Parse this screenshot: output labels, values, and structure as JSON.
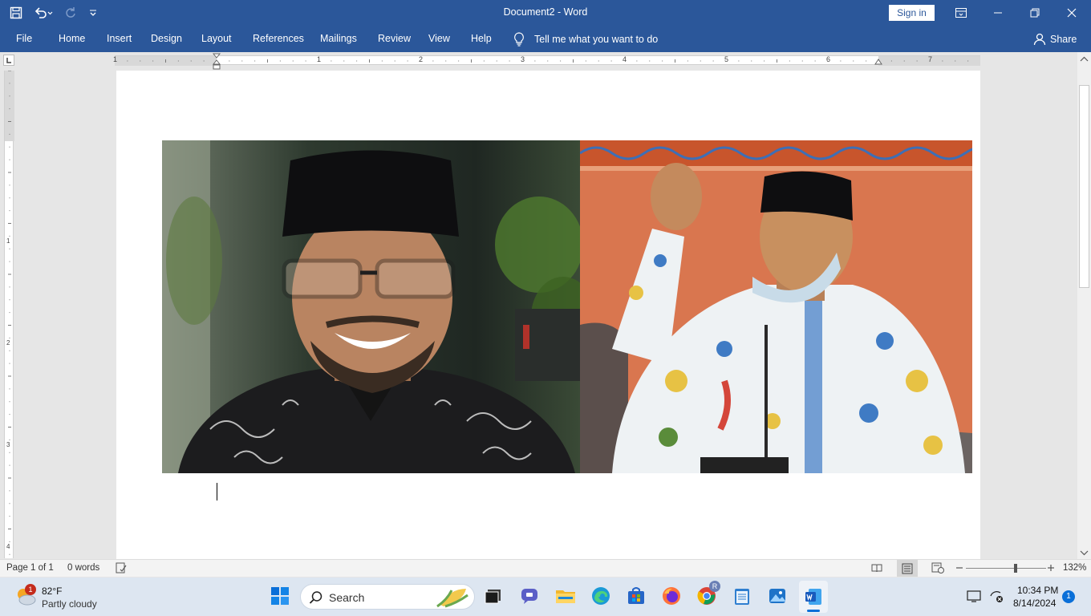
{
  "window": {
    "title": "Document2  -  Word",
    "sign_in": "Sign in"
  },
  "ribbon": {
    "tabs": [
      "File",
      "Home",
      "Insert",
      "Design",
      "Layout",
      "References",
      "Mailings",
      "Review",
      "View",
      "Help"
    ],
    "tell_me": "Tell me what you want to do",
    "share": "Share"
  },
  "ruler": {
    "h_numbers": [
      "1",
      "1",
      "2",
      "3",
      "4",
      "5",
      "6",
      "7"
    ],
    "v_numbers": [
      "1",
      "2",
      "3",
      "4"
    ]
  },
  "document": {
    "images": [
      {
        "name": "left-portrait-photo",
        "icon": "man-smiling-glasses-photo"
      },
      {
        "name": "right-portrait-photo",
        "icon": "man-speaking-batik-photo"
      }
    ]
  },
  "status": {
    "page": "Page 1 of 1",
    "words": "0 words",
    "zoom": "132%",
    "zoom_level": 0.62
  },
  "taskbar": {
    "weather_temp": "82°F",
    "weather_desc": "Partly cloudy",
    "weather_badge": "1",
    "search_placeholder": "Search",
    "chrome_badge": "R",
    "time": "10:34 PM",
    "date": "8/14/2024",
    "notif_count": "1"
  },
  "colors": {
    "word_blue": "#2b579a",
    "taskbar": "#dde6f1"
  }
}
